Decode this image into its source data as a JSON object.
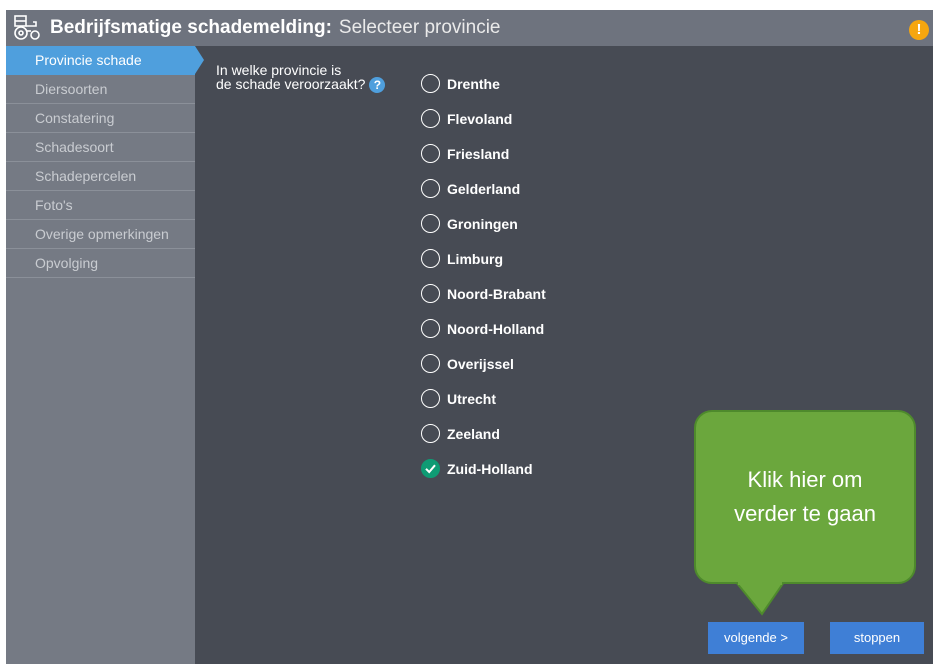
{
  "title": {
    "main": "Bedrijfsmatige schademelding",
    "colon": ":",
    "sub": "Selecteer provincie",
    "warning_symbol": "!",
    "icon": "tractor-icon"
  },
  "sidebar": {
    "items": [
      {
        "label": "Provincie schade",
        "active": true
      },
      {
        "label": "Diersoorten"
      },
      {
        "label": "Constatering"
      },
      {
        "label": "Schadesoort"
      },
      {
        "label": "Schadepercelen"
      },
      {
        "label": "Foto's"
      },
      {
        "label": "Overige opmerkingen"
      },
      {
        "label": "Opvolging"
      }
    ]
  },
  "question": {
    "line1": "In welke provincie is",
    "line2": "de schade veroorzaakt?",
    "help_symbol": "?"
  },
  "options": [
    {
      "label": "Drenthe",
      "checked": false
    },
    {
      "label": "Flevoland",
      "checked": false
    },
    {
      "label": "Friesland",
      "checked": false
    },
    {
      "label": "Gelderland",
      "checked": false
    },
    {
      "label": "Groningen",
      "checked": false
    },
    {
      "label": "Limburg",
      "checked": false
    },
    {
      "label": "Noord-Brabant",
      "checked": false
    },
    {
      "label": "Noord-Holland",
      "checked": false
    },
    {
      "label": "Overijssel",
      "checked": false
    },
    {
      "label": "Utrecht",
      "checked": false
    },
    {
      "label": "Zeeland",
      "checked": false
    },
    {
      "label": "Zuid-Holland",
      "checked": true
    }
  ],
  "callout": {
    "text": "Klik hier om verder te gaan"
  },
  "buttons": {
    "next": "volgende >",
    "stop": "stoppen"
  },
  "colors": {
    "accent": "#4f9fdd",
    "button": "#3f7fd6",
    "checked": "#0f9b74",
    "callout": "#6ba73d",
    "warning": "#f6a60f"
  }
}
